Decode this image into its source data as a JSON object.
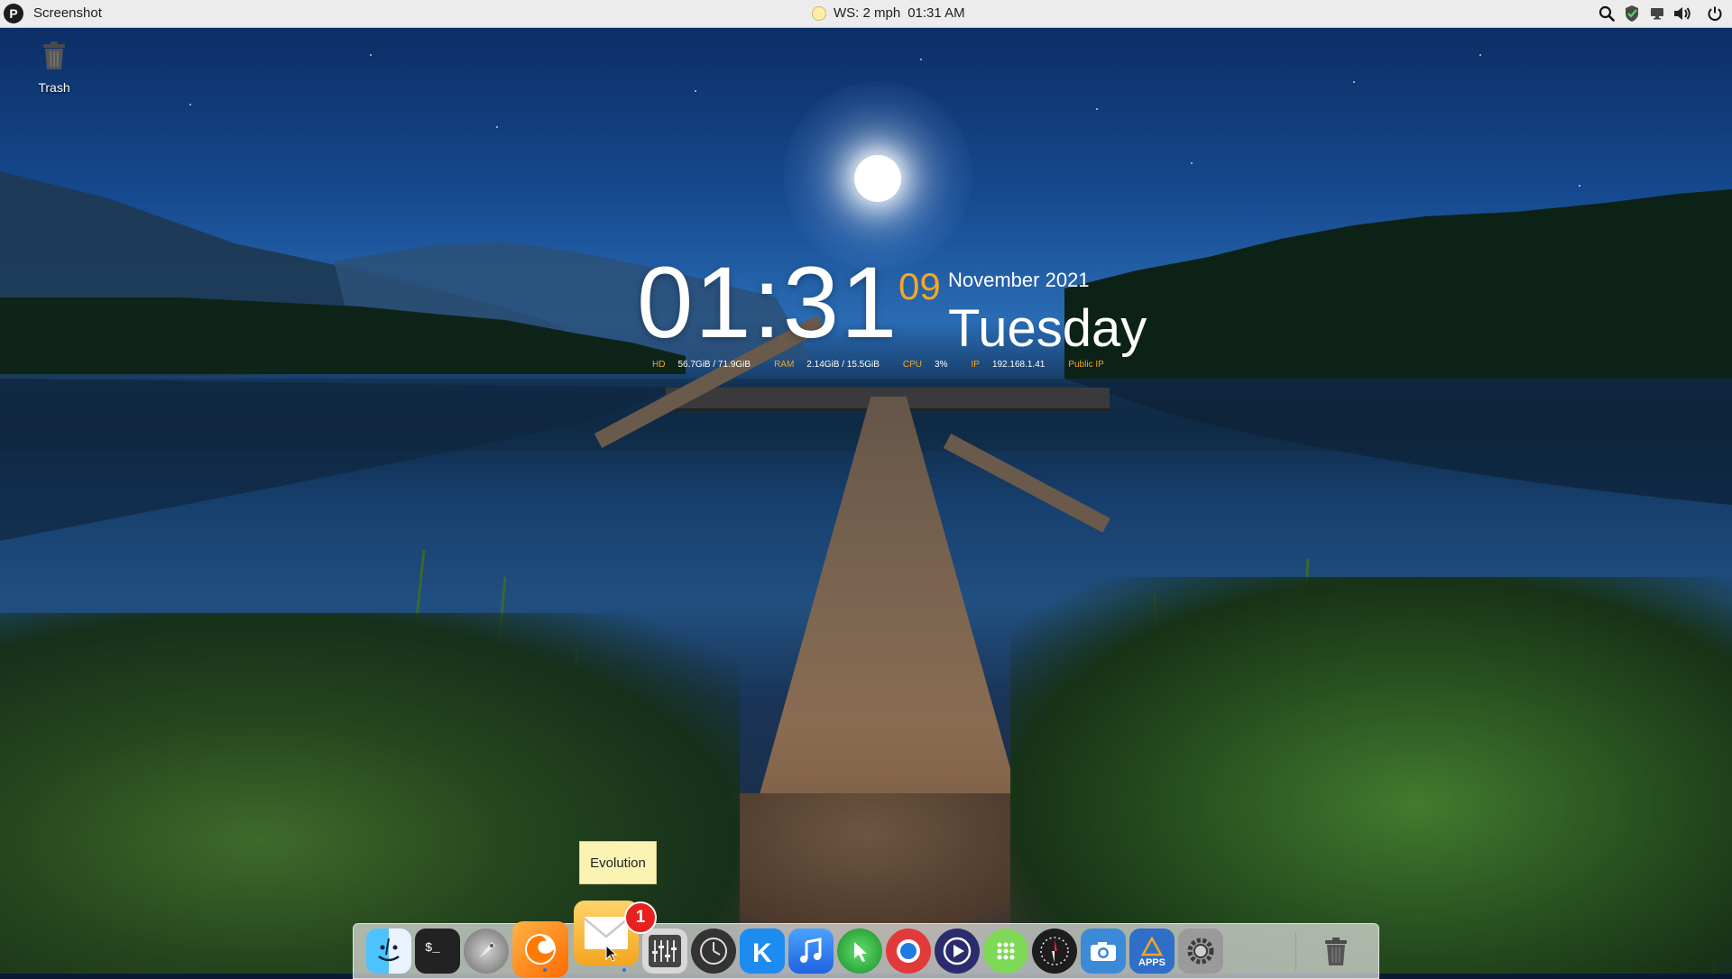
{
  "topbar": {
    "app_name": "Screenshot",
    "weather": "WS: 2 mph",
    "time": "01:31 AM"
  },
  "desktop": {
    "icons": [
      {
        "label": "Trash",
        "icon": "trash-icon"
      }
    ]
  },
  "clock_widget": {
    "time": "01:31",
    "day": "09",
    "month_year": "November 2021",
    "weekday": "Tuesday",
    "stats": [
      {
        "key": "HD",
        "value": "56.7GiB / 71.9GiB"
      },
      {
        "key": "RAM",
        "value": "2.14GiB / 15.5GiB"
      },
      {
        "key": "CPU",
        "value": "3%"
      },
      {
        "key": "IP",
        "value": "192.168.1.41"
      },
      {
        "key": "Public IP",
        "value": ""
      }
    ]
  },
  "tooltip": {
    "label": "Evolution"
  },
  "dock": {
    "badge_count": "1",
    "items": [
      {
        "icon": "finder-icon"
      },
      {
        "icon": "terminal-icon"
      },
      {
        "icon": "launchpad-icon"
      },
      {
        "icon": "firefox-icon"
      },
      {
        "icon": "evolution-mail-icon"
      },
      {
        "icon": "equalizer-icon"
      },
      {
        "icon": "time-machine-icon"
      },
      {
        "icon": "k-app-icon"
      },
      {
        "icon": "music-icon"
      },
      {
        "icon": "green-app-icon"
      },
      {
        "icon": "screen-recorder-icon"
      },
      {
        "icon": "video-player-icon"
      },
      {
        "icon": "launcher-grid-icon"
      },
      {
        "icon": "compass-icon"
      },
      {
        "icon": "camera-icon"
      },
      {
        "icon": "app-store-icon",
        "label": "APPS"
      },
      {
        "icon": "settings-icon"
      },
      {
        "icon": "trash-icon"
      }
    ]
  },
  "colors": {
    "accent_orange": "#f5a623",
    "badge_red": "#e8201e",
    "tooltip_bg": "#fbf3b2",
    "topbar_bg": "#ececec"
  }
}
